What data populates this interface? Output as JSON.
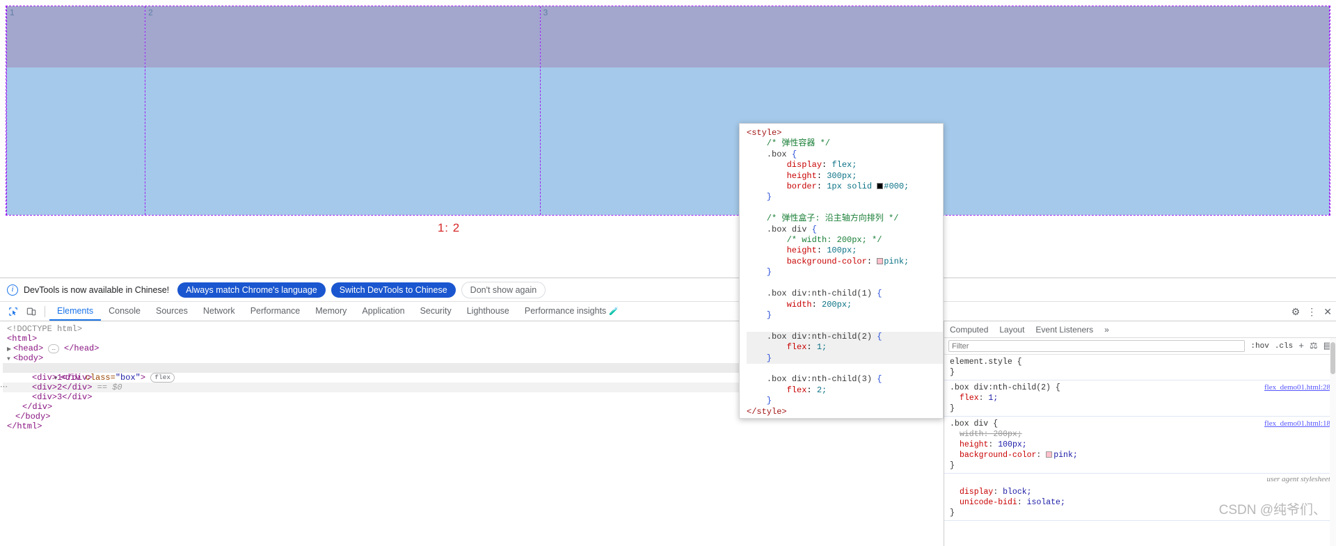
{
  "page": {
    "ratio_label": "1: 2",
    "items": [
      {
        "number": "1",
        "name": "flex-item-1"
      },
      {
        "number": "2",
        "name": "flex-item-2"
      },
      {
        "number": "3",
        "name": "flex-item-3"
      }
    ]
  },
  "devtools": {
    "banner": {
      "icon": "info-icon",
      "message": "DevTools is now available in Chinese!",
      "primary_1": "Always match Chrome's language",
      "primary_2": "Switch DevTools to Chinese",
      "dismiss": "Don't show again"
    },
    "tabs": [
      "Elements",
      "Console",
      "Sources",
      "Network",
      "Performance",
      "Memory",
      "Application",
      "Security",
      "Lighthouse",
      "Performance insights"
    ],
    "selected_tab": "Elements",
    "tool_icons": [
      "inspect-icon",
      "device-toolbar-icon"
    ],
    "right_icons": [
      "settings-gear-icon",
      "more-vertical-icon",
      "close-icon"
    ],
    "dom": {
      "doctype": "<!DOCTYPE html>",
      "html_open": "<html>",
      "head_line": "<head>",
      "head_close": "</head>",
      "head_dots": "…",
      "body_open": "<body>",
      "box_open_tag": "<div",
      "box_attr_name": "class=",
      "box_attr_value": "\"box\"",
      "box_close_bracket": ">",
      "flex_badge": "flex",
      "child1": "<div>1</div>",
      "child2": "<div>2</div>",
      "child2_marker": "== $0",
      "child3": "<div>3</div>",
      "div_close": "</div>",
      "body_close": "</body>",
      "html_close": "</html>"
    },
    "styles": {
      "tabs": [
        "Computed",
        "Layout",
        "Event Listeners"
      ],
      "overflow_tab": "»",
      "filter_placeholder": "Filter",
      "filter_value": "",
      "toolbar": [
        ":hov",
        ".cls",
        "+",
        "paint-icon",
        "sidebar-toggle-icon"
      ],
      "rule_element_style": "element.style {",
      "rule_element_style_close": "}",
      "rule2_selector": ".box div:nth-child(2) {",
      "rule2_source": "flex_demo01.html:28",
      "rule2_prop": "flex",
      "rule2_value": "1;",
      "rule3_selector": ".box div {",
      "rule3_source": "flex_demo01.html:18",
      "rule3_props": [
        {
          "name": "width",
          "value": "200px;",
          "struck": true
        },
        {
          "name": "height",
          "value": "100px;",
          "struck": false
        },
        {
          "name": "background-color",
          "value": "pink;",
          "struck": false,
          "swatch": "#ffc0cb"
        }
      ],
      "ua_label": "user agent stylesheet",
      "ua_props": [
        {
          "name": "display",
          "value": "block;"
        },
        {
          "name": "unicode-bidi",
          "value": "isolate;"
        }
      ],
      "ua_close": "}"
    }
  },
  "code_overlay": {
    "lines": [
      {
        "t": "tag",
        "text": "<style>"
      },
      {
        "t": "com",
        "text": "    /* 弹性容器 */"
      },
      {
        "t": "sel",
        "text": "    .box {"
      },
      {
        "t": "decl",
        "prop": "display",
        "value": "flex;"
      },
      {
        "t": "decl",
        "prop": "height",
        "value": "300px;"
      },
      {
        "t": "decl-sw",
        "prop": "border",
        "value": "1px solid ",
        "swatch": "#000000",
        "tail": "#000;"
      },
      {
        "t": "close",
        "text": "    }"
      },
      {
        "t": "blank",
        "text": ""
      },
      {
        "t": "com",
        "text": "    /* 弹性盒子: 沿主轴方向排列 */"
      },
      {
        "t": "sel",
        "text": "    .box div {"
      },
      {
        "t": "com2",
        "text": "        /* width: 200px; */"
      },
      {
        "t": "decl",
        "prop": "height",
        "value": "100px;"
      },
      {
        "t": "decl-sw",
        "prop": "background-color",
        "value": "",
        "swatch": "#ffc0cb",
        "tail": "pink;"
      },
      {
        "t": "close",
        "text": "    }"
      },
      {
        "t": "blank",
        "text": ""
      },
      {
        "t": "sel",
        "text": "    .box div:nth-child(1) {"
      },
      {
        "t": "decl",
        "prop": "width",
        "value": "200px;"
      },
      {
        "t": "close",
        "text": "    }"
      },
      {
        "t": "blank",
        "text": ""
      },
      {
        "t": "sel-hl",
        "text": "    .box div:nth-child(2) {"
      },
      {
        "t": "decl-hl",
        "prop": "flex",
        "value": "1;"
      },
      {
        "t": "close-hl",
        "text": "    }"
      },
      {
        "t": "blank",
        "text": ""
      },
      {
        "t": "sel",
        "text": "    .box div:nth-child(3) {"
      },
      {
        "t": "decl",
        "prop": "flex",
        "value": "2;"
      },
      {
        "t": "close",
        "text": "    }"
      },
      {
        "t": "tag",
        "text": "</style>"
      }
    ]
  },
  "watermark": "CSDN @纯爷们、",
  "colors": {
    "accent": "#1a73e8",
    "banner_button": "#1a56cf",
    "flex_overlay": "#a020f0",
    "item_fill": "#a5c9ea",
    "item_band": "#a3a6cd",
    "ratio_text": "#d62828"
  }
}
